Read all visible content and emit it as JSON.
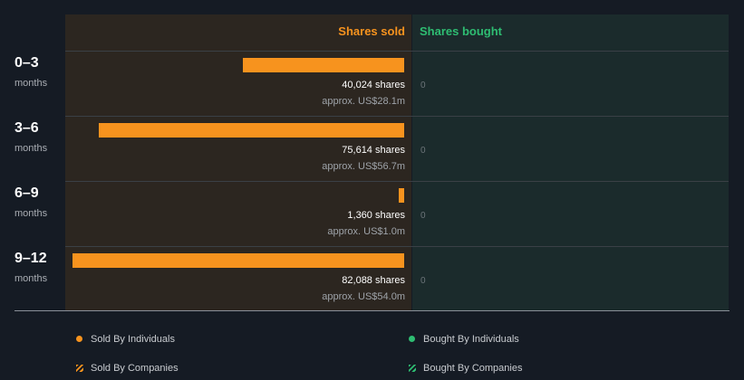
{
  "colors": {
    "sold": "#f7931e",
    "bought": "#2ebd72",
    "sold_bg": "#2c2620",
    "bought_bg": "#1b2b2c",
    "background": "#151b24"
  },
  "chart_data": {
    "type": "bar",
    "orientation": "horizontal",
    "headers": {
      "sold": "Shares sold",
      "bought": "Shares bought"
    },
    "categories": [
      {
        "period": "0–3",
        "unit": "months"
      },
      {
        "period": "3–6",
        "unit": "months"
      },
      {
        "period": "6–9",
        "unit": "months"
      },
      {
        "period": "9–12",
        "unit": "months"
      }
    ],
    "series": [
      {
        "name": "Sold By Individuals",
        "values": [
          40024,
          75614,
          1360,
          82088
        ]
      },
      {
        "name": "Bought By Individuals",
        "values": [
          0,
          0,
          0,
          0
        ]
      }
    ],
    "shares_labels": [
      "40,024 shares",
      "75,614 shares",
      "1,360 shares",
      "82,088 shares"
    ],
    "approx_labels": [
      "approx. US$28.1m",
      "approx. US$56.7m",
      "approx. US$1.0m",
      "approx. US$54.0m"
    ],
    "bought_labels": [
      "0",
      "0",
      "0",
      "0"
    ],
    "legend": [
      {
        "label": "Sold By Individuals",
        "marker": "dot",
        "color": "#f7931e"
      },
      {
        "label": "Bought By Individuals",
        "marker": "dot",
        "color": "#2ebd72"
      },
      {
        "label": "Sold By Companies",
        "marker": "hatch",
        "color": "#f7931e"
      },
      {
        "label": "Bought By Companies",
        "marker": "hatch",
        "color": "#2ebd72"
      }
    ],
    "legend_position": "bottom"
  }
}
